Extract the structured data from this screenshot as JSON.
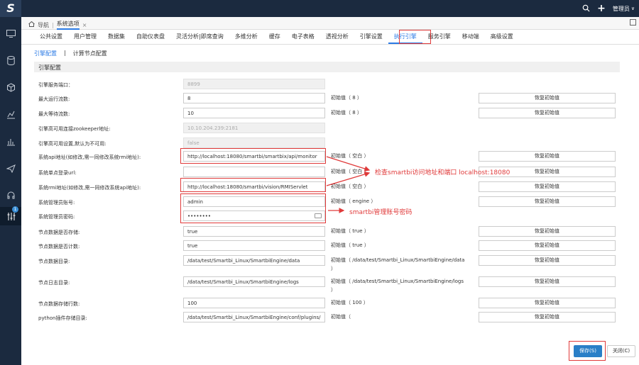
{
  "app": {
    "logo_text": "S"
  },
  "topbar": {
    "user_label": "管理员"
  },
  "tabstrip": {
    "nav_label": "导航",
    "tab_label": "系统选项",
    "close_glyph": "×"
  },
  "nav_tabs": [
    "公共设置",
    "用户管理",
    "数据集",
    "自助仪表盘",
    "灵活分析|即席查询",
    "多维分析",
    "缓存",
    "电子表格",
    "透视分析",
    "引擎设置",
    "执行引擎",
    "服务引擎",
    "移动端",
    "高级设置"
  ],
  "sub_tabs": {
    "engine_config": "引擎配置",
    "separator": "|",
    "compute_node": "计算节点配置"
  },
  "section_title": "引擎配置",
  "restore_label": "恢复初始值",
  "fields": [
    {
      "label": "引擎服务端口：",
      "value": "8899",
      "default": ""
    },
    {
      "label": "最大运行流数:",
      "value": "8",
      "default": "初始值（ 8 ）"
    },
    {
      "label": "最大等待流数:",
      "value": "10",
      "default": "初始值（ 8 ）"
    },
    {
      "label": "引擎高可用连接zookeeper地址:",
      "value": "10.10.204.239:2181",
      "default": ""
    },
    {
      "label": "引擎高可用设置,默认为不可用:",
      "value": "false",
      "default": ""
    },
    {
      "label": "系统api地址(如修改,需一同修改系统rmi地址):",
      "value": "http://localhost:18080/smartbi/smartbix/api/monitor",
      "default": "初始值（ 空白 ）"
    },
    {
      "label": "系统单点登录url:",
      "value": "",
      "default": "初始值（ 空白 ）"
    },
    {
      "label": "系统rmi地址(如修改,需一同修改系统api地址):",
      "value": "http://localhost:18080/smartbi/vision/RMIServlet",
      "default": "初始值（ 空白 ）"
    },
    {
      "label": "系统管理员账号:",
      "value": "admin",
      "default": "初始值（ engine ）"
    },
    {
      "label": "系统管理员密码:",
      "value": "••••••••",
      "default": ""
    },
    {
      "label": "节点数据是否存储:",
      "value": "true",
      "default": "初始值（ true ）"
    },
    {
      "label": "节点数据是否计数:",
      "value": "true",
      "default": "初始值（ true ）"
    },
    {
      "label": "节点数据目录:",
      "value": "/data/test/Smartbi_Linux/SmartbiEngine/data",
      "default": "初始值（ /data/test/Smartbi_Linux/SmartbiEngine/data",
      "default_tail": "）"
    },
    {
      "label": "节点日志目录:",
      "value": "/data/test/Smartbi_Linux/SmartbiEngine/logs",
      "default": "初始值（ /data/test/Smartbi_Linux/SmartbiEngine/logs",
      "default_tail": "）"
    },
    {
      "label": "节点数据存储行数:",
      "value": "100",
      "default": "初始值（ 100 ）"
    },
    {
      "label": "python插件存储目录:",
      "value": "/data/test/Smartbi_Linux/SmartbiEngine/conf/plugins/",
      "default": "初始值（"
    }
  ],
  "annotations": {
    "url_note": "检查smartbi访问地址和端口 localhost:18080",
    "account_note": "smartbi管理账号密码",
    "accent_color": "#e03a3a"
  },
  "buttons": {
    "save": "保存(S)",
    "close": "关闭(C)"
  },
  "sidebar": {
    "badge": "1"
  }
}
